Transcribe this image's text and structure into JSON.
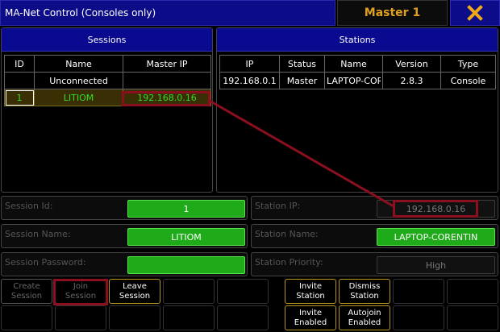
{
  "window": {
    "title": "MA-Net Control (Consoles only)",
    "master_label": "Master 1",
    "close_icon": "close-x-icon"
  },
  "sessions": {
    "title": "Sessions",
    "columns": [
      "ID",
      "Name",
      "Master IP"
    ],
    "rows": [
      {
        "id": "",
        "name": "Unconnected",
        "master_ip": ""
      },
      {
        "id": "1",
        "name": "LITIOM",
        "master_ip": "192.168.0.16"
      }
    ]
  },
  "stations": {
    "title": "Stations",
    "columns": [
      "IP",
      "Status",
      "Name",
      "Version",
      "Type"
    ],
    "rows": [
      {
        "ip": "192.168.0.1",
        "status": "Master",
        "name": "LAPTOP-COR",
        "version": "2.8.3",
        "type": "Console"
      }
    ]
  },
  "session_form": {
    "id_label": "Session Id:",
    "id_value": "1",
    "name_label": "Session Name:",
    "name_value": "LITIOM",
    "password_label": "Session Password:",
    "password_value": ""
  },
  "station_form": {
    "ip_label": "Station IP:",
    "ip_value": "192.168.0.16",
    "name_label": "Station Name:",
    "name_value": "LAPTOP-CORENTIN",
    "priority_label": "Station Priority:",
    "priority_value": "High"
  },
  "buttons": {
    "create_l1": "Create",
    "create_l2": "Session",
    "join_l1": "Join",
    "join_l2": "Session",
    "leave_l1": "Leave",
    "leave_l2": "Session",
    "invite_station_l1": "Invite",
    "invite_station_l2": "Station",
    "dismiss_l1": "Dismiss",
    "dismiss_l2": "Station",
    "invite_enabled_l1": "Invite",
    "invite_enabled_l2": "Enabled",
    "autojoin_l1": "Autojoin",
    "autojoin_l2": "Enabled"
  },
  "colors": {
    "accent_blue": "#0c0c88",
    "highlight_green": "#1faa1a",
    "master_orange": "#e0a020",
    "annotation_red": "#8a1020"
  }
}
